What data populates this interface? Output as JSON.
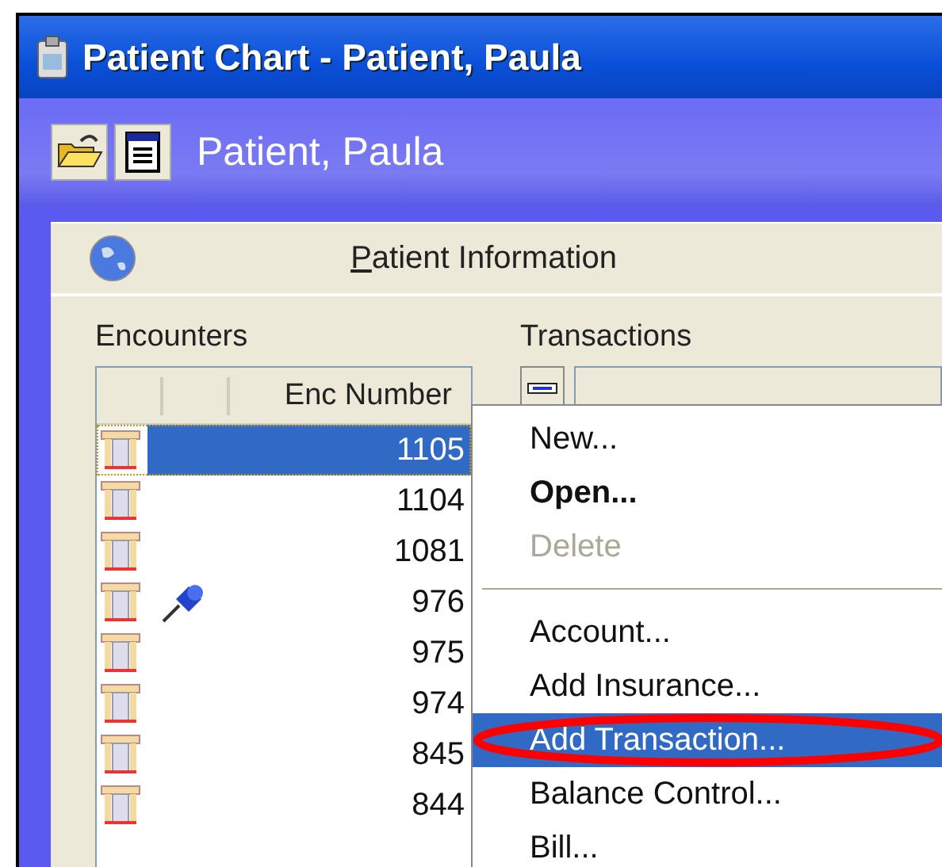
{
  "window": {
    "title": "Patient Chart - Patient, Paula"
  },
  "header": {
    "patient_name": "Patient, Paula"
  },
  "panel": {
    "title_prefix": "P",
    "title_rest": "atient Information"
  },
  "encounters": {
    "label": "Encounters",
    "column": "Enc Number",
    "rows": [
      {
        "number": "1105",
        "selected": true,
        "pinned": false
      },
      {
        "number": "1104",
        "selected": false,
        "pinned": false
      },
      {
        "number": "1081",
        "selected": false,
        "pinned": false
      },
      {
        "number": "976",
        "selected": false,
        "pinned": true
      },
      {
        "number": "975",
        "selected": false,
        "pinned": false
      },
      {
        "number": "974",
        "selected": false,
        "pinned": false
      },
      {
        "number": "845",
        "selected": false,
        "pinned": false
      },
      {
        "number": "844",
        "selected": false,
        "pinned": false
      }
    ]
  },
  "transactions": {
    "label": "Transactions"
  },
  "context_menu": {
    "items": [
      {
        "kind": "item",
        "label": "New...",
        "bold": false,
        "disabled": false,
        "selected": false
      },
      {
        "kind": "item",
        "label": "Open...",
        "bold": true,
        "disabled": false,
        "selected": false
      },
      {
        "kind": "item",
        "label": "Delete",
        "bold": false,
        "disabled": true,
        "selected": false
      },
      {
        "kind": "separator"
      },
      {
        "kind": "item",
        "label": "Account...",
        "bold": false,
        "disabled": false,
        "selected": false
      },
      {
        "kind": "item",
        "label": "Add Insurance...",
        "bold": false,
        "disabled": false,
        "selected": false
      },
      {
        "kind": "item",
        "label": "Add Transaction...",
        "bold": false,
        "disabled": false,
        "selected": true
      },
      {
        "kind": "item",
        "label": "Balance Control...",
        "bold": false,
        "disabled": false,
        "selected": false
      },
      {
        "kind": "item",
        "label": "Bill...",
        "bold": false,
        "disabled": false,
        "selected": false
      }
    ]
  }
}
